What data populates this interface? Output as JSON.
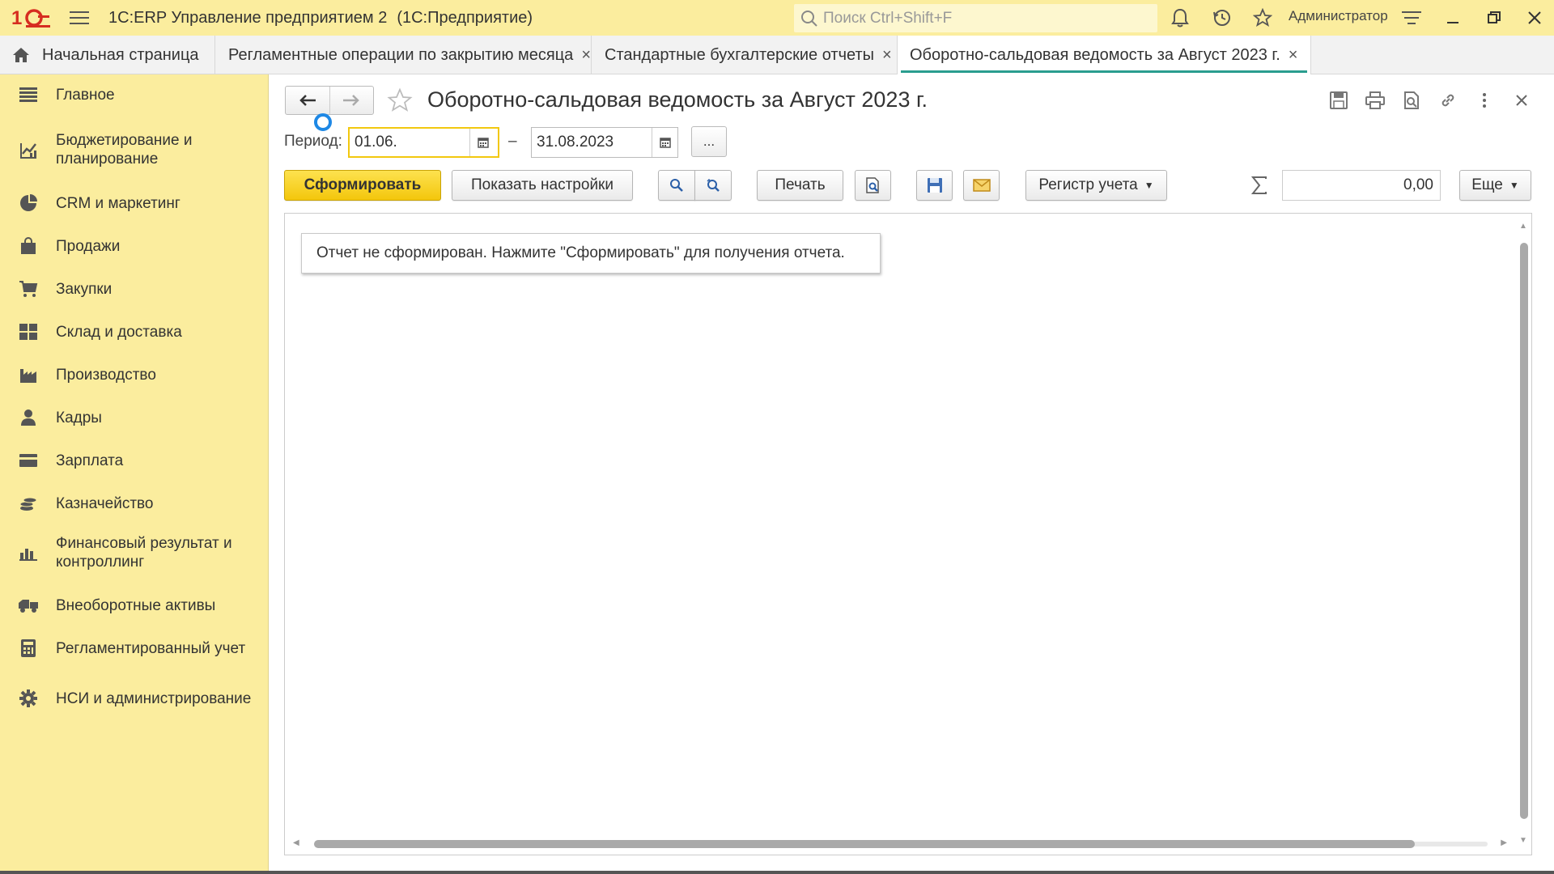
{
  "titlebar": {
    "app_title": "1С:ERP Управление предприятием 2",
    "app_subtitle": "(1С:Предприятие)",
    "search_placeholder": "Поиск Ctrl+Shift+F",
    "user": "Администратор"
  },
  "tabs": [
    {
      "label": "Начальная страница",
      "icon": "home-icon"
    },
    {
      "label": "Регламентные операции по закрытию месяца",
      "close": "×"
    },
    {
      "label": "Стандартные бухгалтерские отчеты",
      "close": "×"
    },
    {
      "label": "Оборотно-сальдовая ведомость за Август 2023 г.",
      "close": "×",
      "active": true
    }
  ],
  "sidebar": {
    "items": [
      {
        "label": "Главное",
        "icon": "menu-lines-icon"
      },
      {
        "label": "Бюджетирование и планирование",
        "icon": "budget-icon"
      },
      {
        "label": "CRM и маркетинг",
        "icon": "pie-chart-icon"
      },
      {
        "label": "Продажи",
        "icon": "shopping-bag-icon"
      },
      {
        "label": "Закупки",
        "icon": "cart-icon"
      },
      {
        "label": "Склад и доставка",
        "icon": "warehouse-icon"
      },
      {
        "label": "Производство",
        "icon": "factory-icon"
      },
      {
        "label": "Кадры",
        "icon": "person-icon"
      },
      {
        "label": "Зарплата",
        "icon": "card-icon"
      },
      {
        "label": "Казначейство",
        "icon": "coins-icon"
      },
      {
        "label": "Финансовый результат и контроллинг",
        "icon": "bar-chart-icon"
      },
      {
        "label": "Внеоборотные активы",
        "icon": "truck-icon"
      },
      {
        "label": "Регламентированный учет",
        "icon": "calculator-icon"
      },
      {
        "label": "НСИ и администрирование",
        "icon": "gear-icon"
      }
    ]
  },
  "form": {
    "title": "Оборотно-сальдовая ведомость за Август 2023 г.",
    "period_label": "Период:",
    "date_from": "01.06.",
    "date_sep": "–",
    "date_to": "31.08.2023",
    "more_label": "...",
    "generate_label": "Сформировать",
    "settings_label": "Показать настройки",
    "print_label": "Печать",
    "register_label": "Регистр учета",
    "sum_value": "0,00",
    "more_menu_label": "Еще",
    "notice": "Отчет не сформирован. Нажмите \"Сформировать\" для получения отчета."
  },
  "colors": {
    "titlebar_bg": "#fbed9e",
    "sidebar_bg": "#fbed9e",
    "primary_button": "#f3c60c",
    "active_tab_underline": "#2a9d8f",
    "focus_border": "#f2c80f"
  }
}
